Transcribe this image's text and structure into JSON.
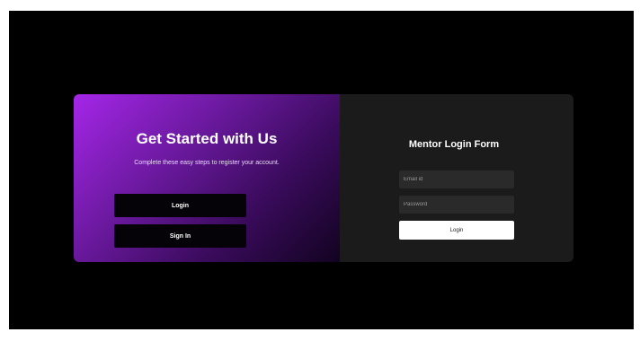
{
  "hero": {
    "title": "Get Started with Us",
    "subtitle": "Complete these easy steps to register your account.",
    "login_label": "Login",
    "signin_label": "Sign In"
  },
  "form": {
    "title": "Mentor Login Form",
    "email_placeholder": "Email id",
    "password_placeholder": "Password",
    "submit_label": "Login"
  },
  "colors": {
    "page_background": "#000000",
    "gradient_start": "#a526e8",
    "gradient_end": "#120320",
    "form_panel": "#1b1b1b"
  }
}
